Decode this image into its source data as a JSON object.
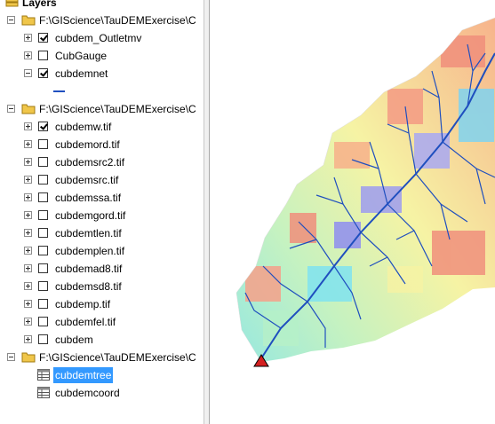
{
  "toc": {
    "title": "Layers",
    "groups": [
      {
        "path": "F:\\GIScience\\TauDEMExercise\\C",
        "layers": [
          {
            "name": "cubdem_Outletmv",
            "checked": true
          },
          {
            "name": "CubGauge",
            "checked": false
          },
          {
            "name": "cubdemnet",
            "checked": true
          }
        ]
      },
      {
        "path": "F:\\GIScience\\TauDEMExercise\\C",
        "layers": [
          {
            "name": "cubdemw.tif",
            "checked": true
          },
          {
            "name": "cubdemord.tif",
            "checked": false
          },
          {
            "name": "cubdemsrc2.tif",
            "checked": false
          },
          {
            "name": "cubdemsrc.tif",
            "checked": false
          },
          {
            "name": "cubdemssa.tif",
            "checked": false
          },
          {
            "name": "cubdemgord.tif",
            "checked": false
          },
          {
            "name": "cubdemtlen.tif",
            "checked": false
          },
          {
            "name": "cubdemplen.tif",
            "checked": false
          },
          {
            "name": "cubdemad8.tif",
            "checked": false
          },
          {
            "name": "cubdemsd8.tif",
            "checked": false
          },
          {
            "name": "cubdemp.tif",
            "checked": false
          },
          {
            "name": "cubdemfel.tif",
            "checked": false
          },
          {
            "name": "cubdem",
            "checked": false
          }
        ]
      },
      {
        "path": "F:\\GIScience\\TauDEMExercise\\C",
        "tables": [
          {
            "name": "cubdemtree",
            "selected": true
          },
          {
            "name": "cubdemcoord",
            "selected": false
          }
        ]
      }
    ]
  },
  "colors": {
    "selection": "#3399ff",
    "stream": "#1f4fbf",
    "folder": "#f0c64a",
    "outlet": "#d42020"
  }
}
